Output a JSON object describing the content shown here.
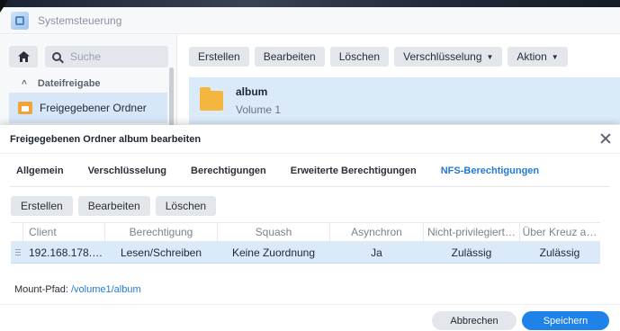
{
  "window": {
    "title": "Systemsteuerung"
  },
  "sidebar": {
    "search_placeholder": "Suche",
    "section_label": "Dateifreigabe",
    "selected_item": "Freigegebener Ordner"
  },
  "toolbar": {
    "create": "Erstellen",
    "edit": "Bearbeiten",
    "delete": "Löschen",
    "encryption": "Verschlüsselung",
    "action": "Aktion"
  },
  "share": {
    "name": "album",
    "volume": "Volume 1"
  },
  "dialog": {
    "title": "Freigegebenen Ordner album bearbeiten",
    "tabs": [
      "Allgemein",
      "Verschlüsselung",
      "Berechtigungen",
      "Erweiterte Berechtigungen",
      "NFS-Berechtigungen"
    ],
    "active_tab": "NFS-Berechtigungen",
    "buttons": {
      "create": "Erstellen",
      "edit": "Bearbeiten",
      "delete": "Löschen"
    },
    "columns": [
      "Client",
      "Berechtigung",
      "Squash",
      "Asynchron",
      "Nicht-privilegiert…",
      "Über Kreuz a…"
    ],
    "rows": [
      {
        "client": "192.168.178.…",
        "permission": "Lesen/Schreiben",
        "squash": "Keine Zuordnung",
        "async": "Ja",
        "non_privileged": "Zulässig",
        "cross_mount": "Zulässig"
      }
    ],
    "mount_label": "Mount-Pfad:",
    "mount_path": "/volume1/album",
    "cancel": "Abbrechen",
    "save": "Speichern"
  }
}
